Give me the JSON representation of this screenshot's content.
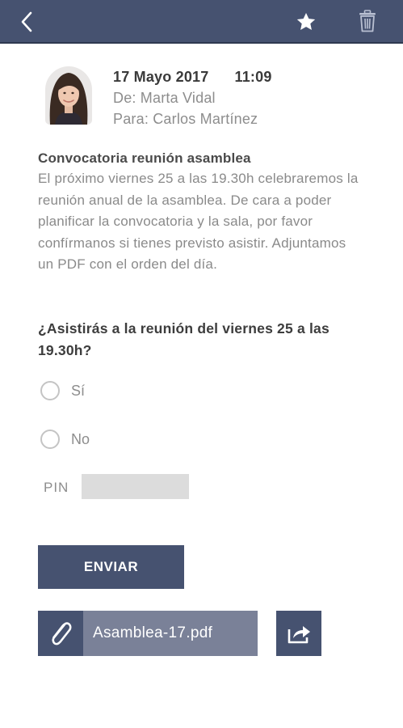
{
  "header": {
    "back_icon": "chevron-left-icon",
    "favorite_icon": "star-icon",
    "delete_icon": "trash-icon",
    "bar_color": "#465270"
  },
  "message": {
    "date": "17 Mayo 2017",
    "time": "11:09",
    "from": "De: Marta Vidal",
    "to": "Para: Carlos Martínez",
    "subject": "Convocatoria reunión asamblea",
    "body": "El próximo viernes 25 a las 19.30h celebraremos la reunión anual de la asamblea. De cara a poder planificar la convocatoria y la sala, por favor confírmanos si tienes previsto asistir. Adjuntamos un PDF con el orden del día."
  },
  "form": {
    "question": "¿Asistirás a la reunión del viernes 25 a las 19.30h?",
    "options": [
      "Sí",
      "No"
    ],
    "pin_label": "PIN",
    "pin_value": "",
    "send_label": "ENVIAR"
  },
  "attachment": {
    "icon": "paperclip-icon",
    "filename": "Asamblea-17.pdf",
    "share_icon": "share-icon"
  }
}
